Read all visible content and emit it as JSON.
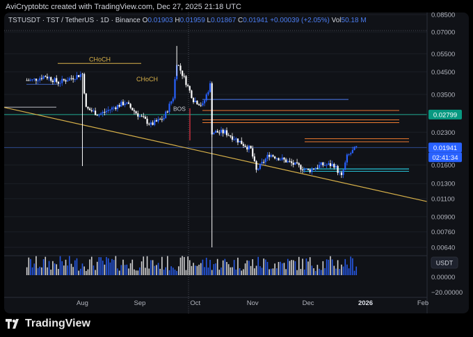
{
  "credit": "AviCryptobtc created with TradingView.com, Dec 27, 2025 21:18 UTC",
  "brand": "TradingView",
  "legend": {
    "symbol": "TSTUSDT · TST / TetherUS · 1D · Binance",
    "o_label": "O",
    "o_value": "0.01903",
    "h_label": "H",
    "h_value": "0.01959",
    "l_label": "L",
    "l_value": "0.01867",
    "c_label": "C",
    "c_value": "0.01941",
    "change": "+0.00039 (+2.05%)",
    "vol_label": "Vol",
    "vol_value": "50.18 M"
  },
  "colors": {
    "up": "#2962ff",
    "down": "#ffffff",
    "support": "#d9b24a",
    "orange": "#f07b30",
    "green": "#22ab94",
    "blue": "#4c7ef3",
    "cyan": "#26c6da"
  },
  "chart_data": {
    "type": "candlestick",
    "price_axis": {
      "scale": "log",
      "ticks": [
        "0.08500",
        "0.07000",
        "0.05500",
        "0.04500",
        "0.03500",
        "0.02300",
        "0.01600",
        "0.01300",
        "0.01100",
        "0.00900",
        "0.00760",
        "0.00640"
      ],
      "current_price_label": "0.01941",
      "countdown_label": "02:41:34",
      "marker_label": "0.02799"
    },
    "x_axis": {
      "ticks": [
        "Aug",
        "Sep",
        "Oct",
        "Nov",
        "Dec",
        "2026",
        "Feb"
      ]
    },
    "annotations": [
      "CHoCH",
      "CHoCH",
      "BOS"
    ],
    "indicator": {
      "unit": "USDT",
      "ticks": [
        "0.00000",
        "−20.00000"
      ]
    },
    "key_levels": [
      0.02799,
      0.0331,
      0.0293,
      0.0264,
      0.0256,
      0.0214,
      0.0207,
      0.0153,
      0.0149
    ],
    "series_points": [
      [
        "2025-07-05",
        0.041
      ],
      [
        "2025-07-12",
        0.043
      ],
      [
        "2025-07-19",
        0.04
      ],
      [
        "2025-07-26",
        0.042
      ],
      [
        "2025-08-01",
        0.044
      ],
      [
        "2025-08-03",
        0.03
      ],
      [
        "2025-08-10",
        0.028
      ],
      [
        "2025-08-17",
        0.03
      ],
      [
        "2025-08-24",
        0.032
      ],
      [
        "2025-08-31",
        0.028
      ],
      [
        "2025-09-07",
        0.025
      ],
      [
        "2025-09-14",
        0.027
      ],
      [
        "2025-09-19",
        0.034
      ],
      [
        "2025-09-21",
        0.05
      ],
      [
        "2025-09-25",
        0.042
      ],
      [
        "2025-09-30",
        0.033
      ],
      [
        "2025-10-05",
        0.031
      ],
      [
        "2025-10-09",
        0.039
      ],
      [
        "2025-10-10",
        0.023
      ],
      [
        "2025-10-17",
        0.023
      ],
      [
        "2025-10-24",
        0.021
      ],
      [
        "2025-10-31",
        0.019
      ],
      [
        "2025-11-03",
        0.015
      ],
      [
        "2025-11-10",
        0.018
      ],
      [
        "2025-11-17",
        0.017
      ],
      [
        "2025-11-24",
        0.016
      ],
      [
        "2025-12-01",
        0.015
      ],
      [
        "2025-12-08",
        0.016
      ],
      [
        "2025-12-15",
        0.016
      ],
      [
        "2025-12-19",
        0.014
      ],
      [
        "2025-12-22",
        0.0175
      ],
      [
        "2025-12-27",
        0.0194
      ]
    ]
  }
}
